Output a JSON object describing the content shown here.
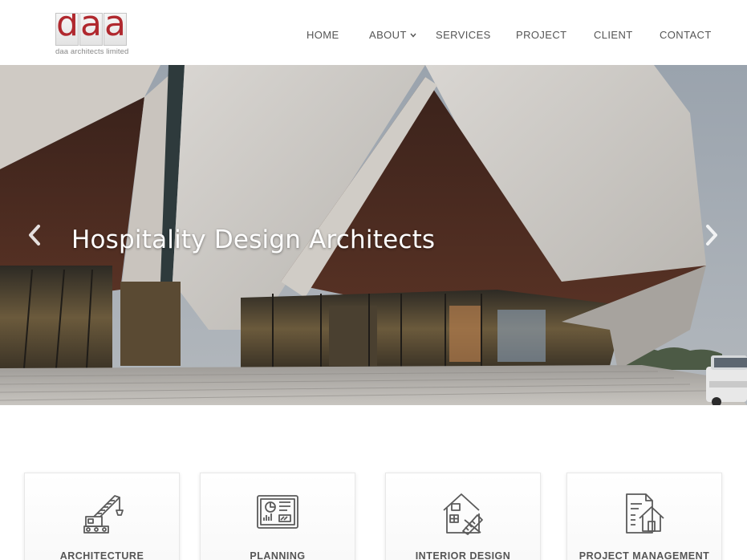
{
  "logo": {
    "letters": [
      "d",
      "a",
      "a"
    ],
    "tagline": "daa architects limited",
    "brand_color": "#b0282e"
  },
  "nav": {
    "items": [
      {
        "label": "HOME"
      },
      {
        "label": "ABOUT",
        "has_dropdown": true
      },
      {
        "label": "SERVICES"
      },
      {
        "label": "PROJECT"
      },
      {
        "label": "CLIENT"
      },
      {
        "label": "CONTACT"
      }
    ]
  },
  "hero": {
    "caption": "Hospitality Design Architects",
    "prev_icon": "chevron-left-icon",
    "next_icon": "chevron-right-icon"
  },
  "services": [
    {
      "label": "ARCHITECTURE",
      "icon": "crane-icon"
    },
    {
      "label": "PLANNING",
      "icon": "blueprint-icon"
    },
    {
      "label": "INTERIOR DESIGN",
      "icon": "house-design-icon"
    },
    {
      "label": "PROJECT MANAGEMENT",
      "icon": "document-house-icon"
    }
  ],
  "colors": {
    "nav_text": "#555555",
    "icon_stroke": "#5a5a5a"
  }
}
